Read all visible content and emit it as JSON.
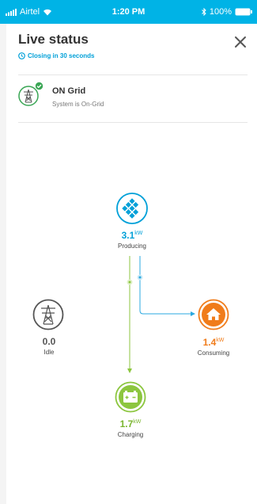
{
  "status_bar": {
    "carrier": "Airtel",
    "time": "1:20 PM",
    "battery": "100%"
  },
  "header": {
    "title": "Live status",
    "countdown": "Closing in 30 seconds"
  },
  "grid_status": {
    "title": "ON Grid",
    "subtitle": "System is On-Grid"
  },
  "nodes": {
    "solar": {
      "value": "3.1",
      "unit": "kW",
      "label": "Producing"
    },
    "grid": {
      "value": "0.0",
      "label": "Idle"
    },
    "home": {
      "value": "1.4",
      "unit": "kW",
      "label": "Consuming"
    },
    "battery": {
      "value": "1.7",
      "unit": "kW",
      "label": "Charging"
    }
  },
  "icons": [
    "signal-icon",
    "wifi-icon",
    "bluetooth-icon",
    "battery-icon",
    "clock-icon",
    "close-icon",
    "power-tower-icon",
    "check-icon",
    "solar-panel-icon",
    "home-icon",
    "battery-charging-icon"
  ],
  "colors": {
    "accent": "#00b3e6",
    "green": "#8cc63f",
    "orange": "#f07c1b",
    "grey": "#555555",
    "flow_blue": "#2aa8e0",
    "flow_green": "#8cc63f"
  }
}
